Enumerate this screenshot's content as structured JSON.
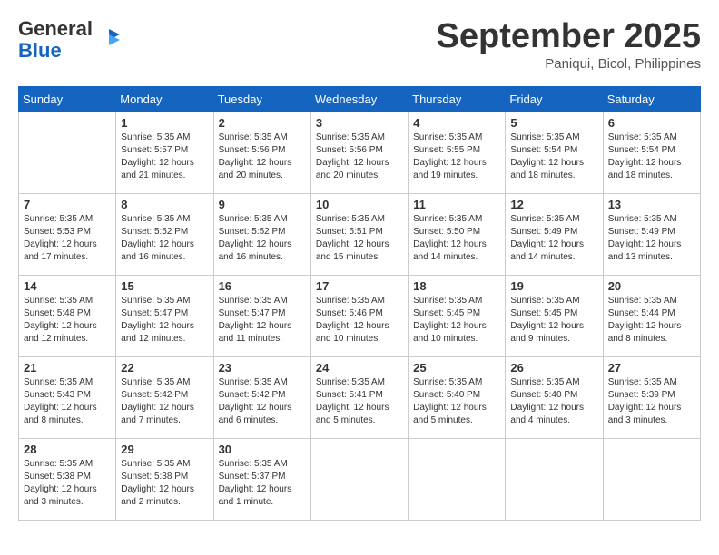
{
  "header": {
    "logo_general": "General",
    "logo_blue": "Blue",
    "month_title": "September 2025",
    "location": "Paniqui, Bicol, Philippines"
  },
  "days_of_week": [
    "Sunday",
    "Monday",
    "Tuesday",
    "Wednesday",
    "Thursday",
    "Friday",
    "Saturday"
  ],
  "weeks": [
    [
      {
        "day": "",
        "info": ""
      },
      {
        "day": "1",
        "info": "Sunrise: 5:35 AM\nSunset: 5:57 PM\nDaylight: 12 hours\nand 21 minutes."
      },
      {
        "day": "2",
        "info": "Sunrise: 5:35 AM\nSunset: 5:56 PM\nDaylight: 12 hours\nand 20 minutes."
      },
      {
        "day": "3",
        "info": "Sunrise: 5:35 AM\nSunset: 5:56 PM\nDaylight: 12 hours\nand 20 minutes."
      },
      {
        "day": "4",
        "info": "Sunrise: 5:35 AM\nSunset: 5:55 PM\nDaylight: 12 hours\nand 19 minutes."
      },
      {
        "day": "5",
        "info": "Sunrise: 5:35 AM\nSunset: 5:54 PM\nDaylight: 12 hours\nand 18 minutes."
      },
      {
        "day": "6",
        "info": "Sunrise: 5:35 AM\nSunset: 5:54 PM\nDaylight: 12 hours\nand 18 minutes."
      }
    ],
    [
      {
        "day": "7",
        "info": "Sunrise: 5:35 AM\nSunset: 5:53 PM\nDaylight: 12 hours\nand 17 minutes."
      },
      {
        "day": "8",
        "info": "Sunrise: 5:35 AM\nSunset: 5:52 PM\nDaylight: 12 hours\nand 16 minutes."
      },
      {
        "day": "9",
        "info": "Sunrise: 5:35 AM\nSunset: 5:52 PM\nDaylight: 12 hours\nand 16 minutes."
      },
      {
        "day": "10",
        "info": "Sunrise: 5:35 AM\nSunset: 5:51 PM\nDaylight: 12 hours\nand 15 minutes."
      },
      {
        "day": "11",
        "info": "Sunrise: 5:35 AM\nSunset: 5:50 PM\nDaylight: 12 hours\nand 14 minutes."
      },
      {
        "day": "12",
        "info": "Sunrise: 5:35 AM\nSunset: 5:49 PM\nDaylight: 12 hours\nand 14 minutes."
      },
      {
        "day": "13",
        "info": "Sunrise: 5:35 AM\nSunset: 5:49 PM\nDaylight: 12 hours\nand 13 minutes."
      }
    ],
    [
      {
        "day": "14",
        "info": "Sunrise: 5:35 AM\nSunset: 5:48 PM\nDaylight: 12 hours\nand 12 minutes."
      },
      {
        "day": "15",
        "info": "Sunrise: 5:35 AM\nSunset: 5:47 PM\nDaylight: 12 hours\nand 12 minutes."
      },
      {
        "day": "16",
        "info": "Sunrise: 5:35 AM\nSunset: 5:47 PM\nDaylight: 12 hours\nand 11 minutes."
      },
      {
        "day": "17",
        "info": "Sunrise: 5:35 AM\nSunset: 5:46 PM\nDaylight: 12 hours\nand 10 minutes."
      },
      {
        "day": "18",
        "info": "Sunrise: 5:35 AM\nSunset: 5:45 PM\nDaylight: 12 hours\nand 10 minutes."
      },
      {
        "day": "19",
        "info": "Sunrise: 5:35 AM\nSunset: 5:45 PM\nDaylight: 12 hours\nand 9 minutes."
      },
      {
        "day": "20",
        "info": "Sunrise: 5:35 AM\nSunset: 5:44 PM\nDaylight: 12 hours\nand 8 minutes."
      }
    ],
    [
      {
        "day": "21",
        "info": "Sunrise: 5:35 AM\nSunset: 5:43 PM\nDaylight: 12 hours\nand 8 minutes."
      },
      {
        "day": "22",
        "info": "Sunrise: 5:35 AM\nSunset: 5:42 PM\nDaylight: 12 hours\nand 7 minutes."
      },
      {
        "day": "23",
        "info": "Sunrise: 5:35 AM\nSunset: 5:42 PM\nDaylight: 12 hours\nand 6 minutes."
      },
      {
        "day": "24",
        "info": "Sunrise: 5:35 AM\nSunset: 5:41 PM\nDaylight: 12 hours\nand 5 minutes."
      },
      {
        "day": "25",
        "info": "Sunrise: 5:35 AM\nSunset: 5:40 PM\nDaylight: 12 hours\nand 5 minutes."
      },
      {
        "day": "26",
        "info": "Sunrise: 5:35 AM\nSunset: 5:40 PM\nDaylight: 12 hours\nand 4 minutes."
      },
      {
        "day": "27",
        "info": "Sunrise: 5:35 AM\nSunset: 5:39 PM\nDaylight: 12 hours\nand 3 minutes."
      }
    ],
    [
      {
        "day": "28",
        "info": "Sunrise: 5:35 AM\nSunset: 5:38 PM\nDaylight: 12 hours\nand 3 minutes."
      },
      {
        "day": "29",
        "info": "Sunrise: 5:35 AM\nSunset: 5:38 PM\nDaylight: 12 hours\nand 2 minutes."
      },
      {
        "day": "30",
        "info": "Sunrise: 5:35 AM\nSunset: 5:37 PM\nDaylight: 12 hours\nand 1 minute."
      },
      {
        "day": "",
        "info": ""
      },
      {
        "day": "",
        "info": ""
      },
      {
        "day": "",
        "info": ""
      },
      {
        "day": "",
        "info": ""
      }
    ]
  ]
}
